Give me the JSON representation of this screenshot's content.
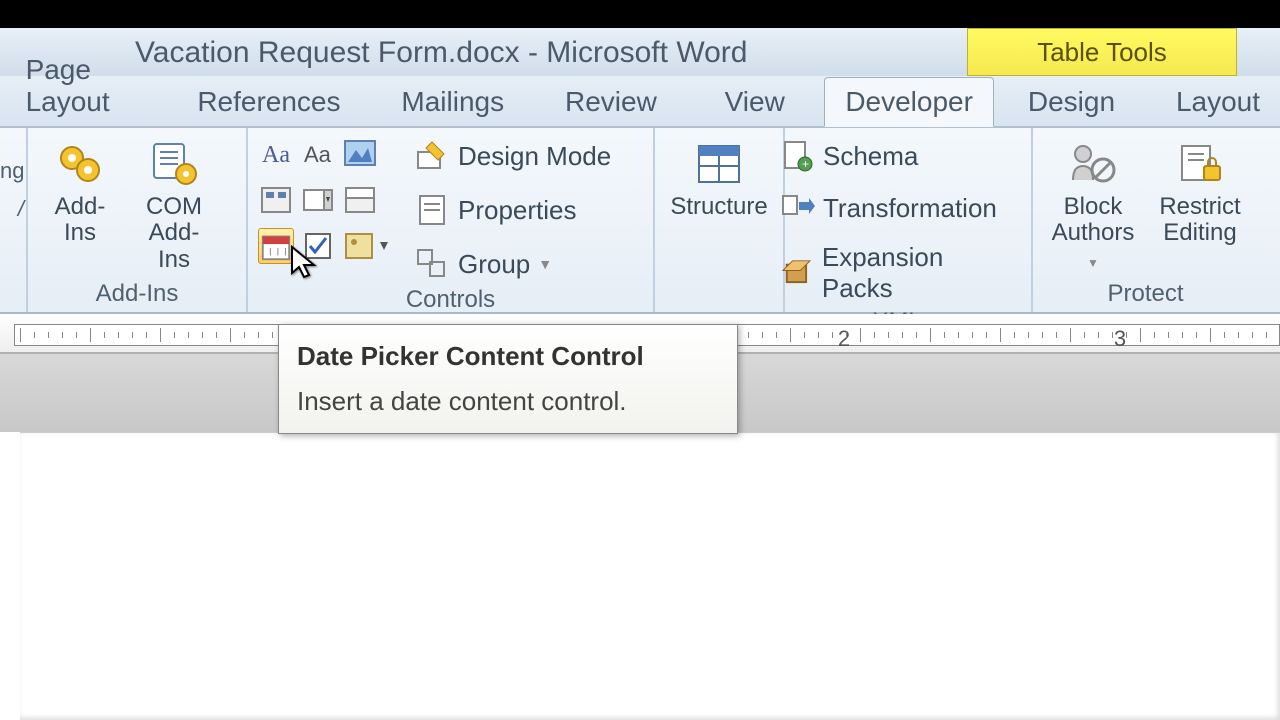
{
  "title": {
    "doc": "Vacation Request Form.docx",
    "app": "Microsoft Word",
    "sep": "  -  "
  },
  "contextual_tab": "Table Tools",
  "tabs": {
    "page_layout": "Page Layout",
    "references": "References",
    "mailings": "Mailings",
    "review": "Review",
    "view": "View",
    "developer": "Developer",
    "design": "Design",
    "layout": "Layout"
  },
  "left_edge": {
    "line1": "ng",
    "line2": "/"
  },
  "addins": {
    "add_ins": "Add-Ins",
    "com1": "COM",
    "com2": "Add-Ins",
    "group": "Add-Ins"
  },
  "controls": {
    "design_mode": "Design Mode",
    "properties": "Properties",
    "group_btn": "Group",
    "group": "Controls"
  },
  "structure": {
    "label": "Structure"
  },
  "xml": {
    "schema": "Schema",
    "transformation": "Transformation",
    "expansion": "Expansion Packs",
    "group": "XML"
  },
  "protect": {
    "block1": "Block",
    "block2": "Authors",
    "restrict1": "Restrict",
    "restrict2": "Editing",
    "group": "Protect"
  },
  "tooltip": {
    "title": "Date Picker Content Control",
    "desc": "Insert a date content control."
  },
  "ruler": {
    "marks": [
      "2",
      "3"
    ]
  }
}
